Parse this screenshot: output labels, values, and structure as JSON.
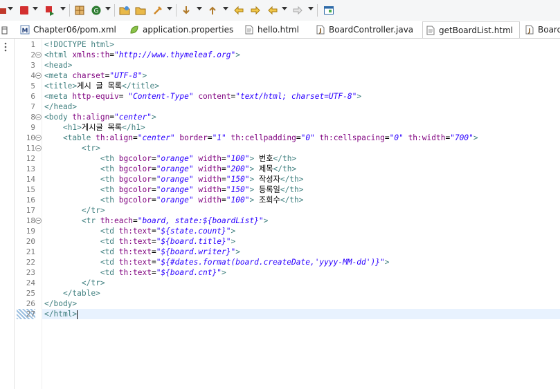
{
  "tabs": [
    {
      "label": "Chapter06/pom.xml",
      "icon": "maven-pom-icon"
    },
    {
      "label": "application.properties",
      "icon": "properties-leaf-icon"
    },
    {
      "label": "hello.html",
      "icon": "html-file-icon"
    },
    {
      "label": "BoardController.java",
      "icon": "java-file-icon"
    },
    {
      "label": "getBoardList.html",
      "icon": "html-file-icon",
      "active": true
    },
    {
      "label": "Board.",
      "icon": "java-file-icon"
    }
  ],
  "close_glyph": "✕",
  "editor": {
    "current_line": 27,
    "lines": [
      [
        [
          "t",
          "<!DOCTYPE html>"
        ]
      ],
      [
        [
          "t",
          "<html "
        ],
        [
          "a",
          "xmlns:th"
        ],
        [
          "x",
          "="
        ],
        [
          "v",
          "\"http://www.thymeleaf.org\""
        ],
        [
          "t",
          ">"
        ]
      ],
      [
        [
          "t",
          "<head>"
        ]
      ],
      [
        [
          "t",
          "<meta "
        ],
        [
          "a",
          "charset"
        ],
        [
          "x",
          "="
        ],
        [
          "v",
          "\"UTF-8\""
        ],
        [
          "t",
          ">"
        ]
      ],
      [
        [
          "t",
          "<title>"
        ],
        [
          "x",
          "게시 글 목록"
        ],
        [
          "t",
          "</title>"
        ]
      ],
      [
        [
          "t",
          "<meta "
        ],
        [
          "a",
          "http-equiv"
        ],
        [
          "x",
          "= "
        ],
        [
          "v",
          "\"Content-Type\""
        ],
        [
          "x",
          " "
        ],
        [
          "a",
          "content"
        ],
        [
          "x",
          "="
        ],
        [
          "v",
          "\"text/html; charset=UTF-8\""
        ],
        [
          "t",
          ">"
        ]
      ],
      [
        [
          "t",
          "</head>"
        ]
      ],
      [
        [
          "t",
          "<body "
        ],
        [
          "a",
          "th:align"
        ],
        [
          "x",
          "="
        ],
        [
          "v",
          "\"center\""
        ],
        [
          "t",
          ">"
        ]
      ],
      [
        [
          "x",
          "    "
        ],
        [
          "t",
          "<h1>"
        ],
        [
          "x",
          "게시글 목록"
        ],
        [
          "t",
          "</h1>"
        ]
      ],
      [
        [
          "x",
          "    "
        ],
        [
          "t",
          "<table "
        ],
        [
          "a",
          "th:align"
        ],
        [
          "x",
          "="
        ],
        [
          "v",
          "\"center\""
        ],
        [
          "x",
          " "
        ],
        [
          "a",
          "border"
        ],
        [
          "x",
          "="
        ],
        [
          "v",
          "\"1\""
        ],
        [
          "x",
          " "
        ],
        [
          "a",
          "th:cellpadding"
        ],
        [
          "x",
          "="
        ],
        [
          "v",
          "\"0\""
        ],
        [
          "x",
          " "
        ],
        [
          "a",
          "th:cellspacing"
        ],
        [
          "x",
          "="
        ],
        [
          "v",
          "\"0\""
        ],
        [
          "x",
          " "
        ],
        [
          "a",
          "th:width"
        ],
        [
          "x",
          "="
        ],
        [
          "v",
          "\"700\""
        ],
        [
          "t",
          ">"
        ]
      ],
      [
        [
          "x",
          "        "
        ],
        [
          "t",
          "<tr>"
        ]
      ],
      [
        [
          "x",
          "            "
        ],
        [
          "t",
          "<th "
        ],
        [
          "a",
          "bgcolor"
        ],
        [
          "x",
          "="
        ],
        [
          "v",
          "\"orange\""
        ],
        [
          "x",
          " "
        ],
        [
          "a",
          "width"
        ],
        [
          "x",
          "="
        ],
        [
          "v",
          "\"100\""
        ],
        [
          "t",
          ">"
        ],
        [
          "x",
          " 번호"
        ],
        [
          "t",
          "</th>"
        ]
      ],
      [
        [
          "x",
          "            "
        ],
        [
          "t",
          "<th "
        ],
        [
          "a",
          "bgcolor"
        ],
        [
          "x",
          "="
        ],
        [
          "v",
          "\"orange\""
        ],
        [
          "x",
          " "
        ],
        [
          "a",
          "width"
        ],
        [
          "x",
          "="
        ],
        [
          "v",
          "\"200\""
        ],
        [
          "t",
          ">"
        ],
        [
          "x",
          " 제목"
        ],
        [
          "t",
          "</th>"
        ]
      ],
      [
        [
          "x",
          "            "
        ],
        [
          "t",
          "<th "
        ],
        [
          "a",
          "bgcolor"
        ],
        [
          "x",
          "="
        ],
        [
          "v",
          "\"orange\""
        ],
        [
          "x",
          " "
        ],
        [
          "a",
          "width"
        ],
        [
          "x",
          "="
        ],
        [
          "v",
          "\"150\""
        ],
        [
          "t",
          ">"
        ],
        [
          "x",
          " 작성자"
        ],
        [
          "t",
          "</th>"
        ]
      ],
      [
        [
          "x",
          "            "
        ],
        [
          "t",
          "<th "
        ],
        [
          "a",
          "bgcolor"
        ],
        [
          "x",
          "="
        ],
        [
          "v",
          "\"orange\""
        ],
        [
          "x",
          " "
        ],
        [
          "a",
          "width"
        ],
        [
          "x",
          "="
        ],
        [
          "v",
          "\"150\""
        ],
        [
          "t",
          ">"
        ],
        [
          "x",
          " 등록일"
        ],
        [
          "t",
          "</th>"
        ]
      ],
      [
        [
          "x",
          "            "
        ],
        [
          "t",
          "<th "
        ],
        [
          "a",
          "bgcolor"
        ],
        [
          "x",
          "="
        ],
        [
          "v",
          "\"orange\""
        ],
        [
          "x",
          " "
        ],
        [
          "a",
          "width"
        ],
        [
          "x",
          "="
        ],
        [
          "v",
          "\"100\""
        ],
        [
          "t",
          ">"
        ],
        [
          "x",
          " 조회수"
        ],
        [
          "t",
          "</th>"
        ]
      ],
      [
        [
          "x",
          "        "
        ],
        [
          "t",
          "</tr>"
        ]
      ],
      [
        [
          "x",
          "        "
        ],
        [
          "t",
          "<tr "
        ],
        [
          "a",
          "th:each"
        ],
        [
          "x",
          "="
        ],
        [
          "v",
          "\"board, state:${boardList}\""
        ],
        [
          "t",
          ">"
        ]
      ],
      [
        [
          "x",
          "            "
        ],
        [
          "t",
          "<td "
        ],
        [
          "a",
          "th:text"
        ],
        [
          "x",
          "="
        ],
        [
          "v",
          "\"${state.count}\""
        ],
        [
          "t",
          ">"
        ]
      ],
      [
        [
          "x",
          "            "
        ],
        [
          "t",
          "<td "
        ],
        [
          "a",
          "th:text"
        ],
        [
          "x",
          "="
        ],
        [
          "v",
          "\"${board.title}\""
        ],
        [
          "t",
          ">"
        ]
      ],
      [
        [
          "x",
          "            "
        ],
        [
          "t",
          "<td "
        ],
        [
          "a",
          "th:text"
        ],
        [
          "x",
          "="
        ],
        [
          "v",
          "\"${board.writer}\""
        ],
        [
          "t",
          ">"
        ]
      ],
      [
        [
          "x",
          "            "
        ],
        [
          "t",
          "<td "
        ],
        [
          "a",
          "th:text"
        ],
        [
          "x",
          "="
        ],
        [
          "v",
          "\"${#dates.format(board.createDate,'yyyy-MM-dd')}\""
        ],
        [
          "t",
          ">"
        ]
      ],
      [
        [
          "x",
          "            "
        ],
        [
          "t",
          "<td "
        ],
        [
          "a",
          "th:text"
        ],
        [
          "x",
          "="
        ],
        [
          "v",
          "\"${board.cnt}\""
        ],
        [
          "t",
          ">"
        ]
      ],
      [
        [
          "x",
          "        "
        ],
        [
          "t",
          "</tr>"
        ]
      ],
      [
        [
          "x",
          "    "
        ],
        [
          "t",
          "</table>"
        ]
      ],
      [
        [
          "t",
          "</body>"
        ]
      ],
      [
        [
          "t",
          "</html>"
        ]
      ]
    ],
    "fold_lines": [
      2,
      4,
      8,
      10,
      11,
      18
    ]
  },
  "toolbar": {
    "buttons": [
      "debug-icon",
      "stop-icon",
      "terminate-icon",
      "toggle-breakpoint-icon",
      "refresh-icon",
      "open-folder-icon",
      "open-project-icon",
      "run-tool-icon",
      "next-annotation-icon",
      "previous-annotation-icon",
      "back-icon",
      "forward-icon",
      "go-back-icon",
      "go-forward-icon",
      "new-window-icon"
    ]
  }
}
